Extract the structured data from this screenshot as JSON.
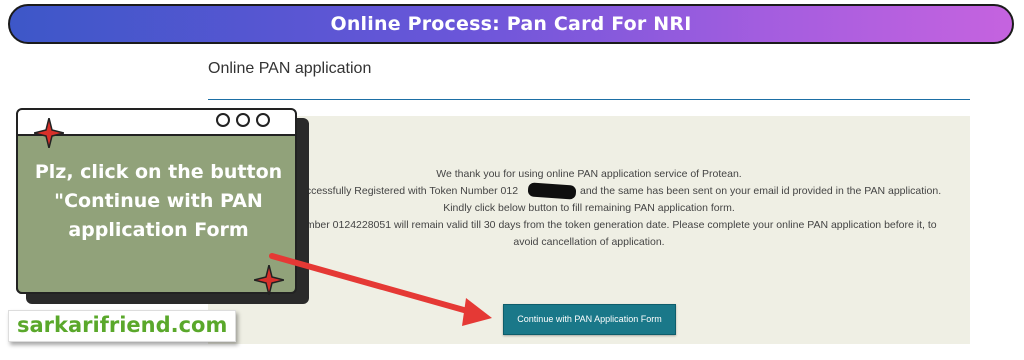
{
  "banner": {
    "title": "Online Process: Pan Card For NRI"
  },
  "page": {
    "heading": "Online PAN application"
  },
  "panel": {
    "line1": "We thank you for using online PAN application service of Protean.",
    "line2": "uccessfully Registered with Token Number 012",
    "line2_end": "and the same has been sent on your email id provided in the PAN application.",
    "line3": "Kindly click below button to fill remaining PAN application form.",
    "line4": "umber 0124228051 will remain valid till 30 days from the token generation date. Please complete your online PAN application before it, to",
    "line5": "avoid cancellation of application.",
    "button_label": "Continue with PAN Application Form"
  },
  "callout": {
    "text": "Plz, click on the button \"Continue with PAN application Form"
  },
  "watermark": {
    "text": "sarkarifriend.com"
  },
  "colors": {
    "banner_start": "#3d57c8",
    "banner_end": "#c563df",
    "button": "#1a7889",
    "callout_bg": "#91a27a",
    "arrow": "#e53935",
    "watermark": "#5aa82b"
  },
  "icons": {
    "sparkle": "four-point-star-icon",
    "window_controls": "circle-icon"
  }
}
